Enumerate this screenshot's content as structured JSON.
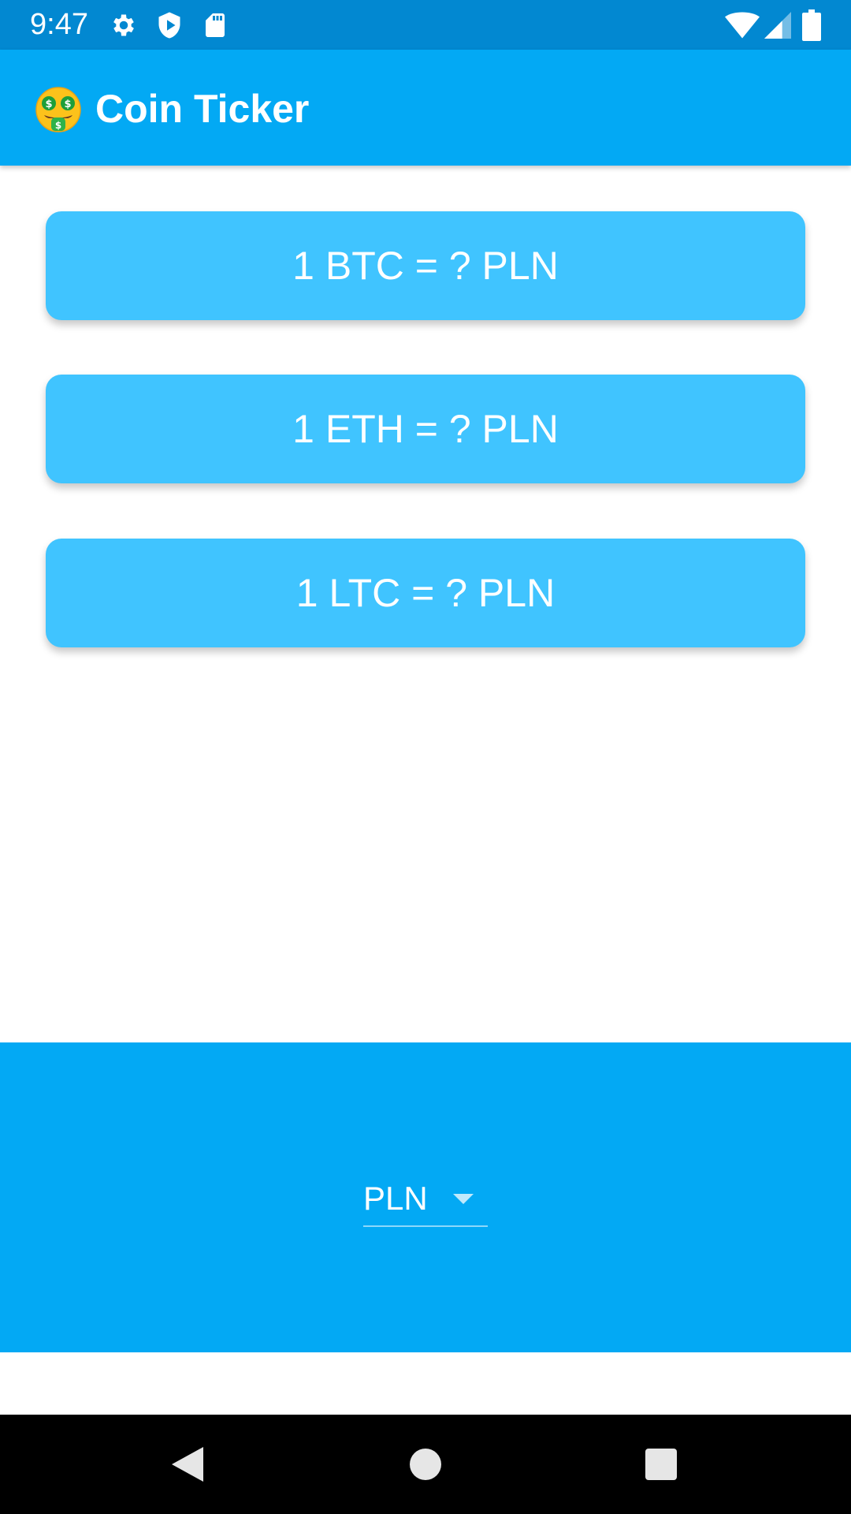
{
  "status_bar": {
    "time": "9:47",
    "icons_left": [
      "gear-icon",
      "shield-play-icon",
      "sd-card-icon"
    ],
    "icons_right": [
      "wifi-icon",
      "cell-signal-icon",
      "battery-icon"
    ]
  },
  "app_bar": {
    "emoji": "money-mouth-face-icon",
    "title": "Coin Ticker"
  },
  "rates": [
    {
      "label": "1 BTC = ? PLN"
    },
    {
      "label": "1 ETH = ? PLN"
    },
    {
      "label": "1 LTC = ? PLN"
    }
  ],
  "currency_picker": {
    "selected": "PLN"
  },
  "nav_bar": {
    "icons": [
      "back-icon",
      "home-icon",
      "recents-icon"
    ]
  },
  "colors": {
    "status_bar": "#0288d1",
    "app_bar": "#03a9f4",
    "card": "#40c4ff",
    "bottom_panel": "#03a9f4",
    "nav_bar": "#000000"
  }
}
